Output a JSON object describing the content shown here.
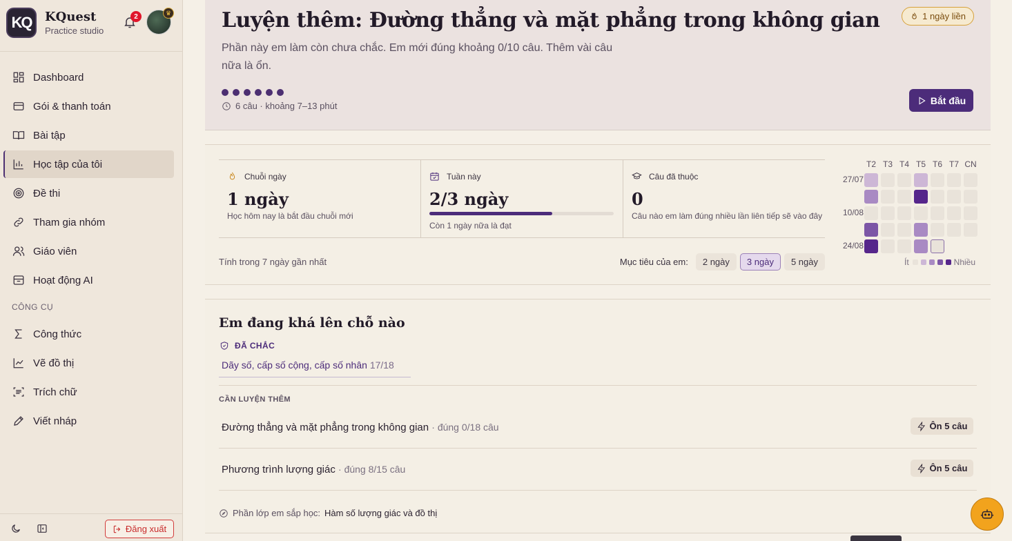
{
  "brand": {
    "logo_text": "KQ",
    "name": "KQuest",
    "subtitle": "Practice studio"
  },
  "notifications": {
    "count": "2"
  },
  "nav": {
    "items": [
      {
        "label": "Dashboard",
        "icon": "dashboard-icon"
      },
      {
        "label": "Gói & thanh toán",
        "icon": "wallet-icon"
      },
      {
        "label": "Bài tập",
        "icon": "book-icon"
      },
      {
        "label": "Học tập của tôi",
        "icon": "chart-icon",
        "active": true
      },
      {
        "label": "Đề thi",
        "icon": "target-icon"
      },
      {
        "label": "Tham gia nhóm",
        "icon": "link-icon"
      },
      {
        "label": "Giáo viên",
        "icon": "users-icon"
      },
      {
        "label": "Hoạt động AI",
        "icon": "archive-icon"
      }
    ],
    "tools_heading": "CÔNG CỤ",
    "tools": [
      {
        "label": "Công thức",
        "icon": "sigma-icon"
      },
      {
        "label": "Vẽ đồ thị",
        "icon": "line-chart-icon"
      },
      {
        "label": "Trích chữ",
        "icon": "scan-text-icon"
      },
      {
        "label": "Viết nháp",
        "icon": "pencil-icon"
      }
    ],
    "logout_label": "Đăng xuất"
  },
  "hero": {
    "title": "Luyện thêm: Đường thẳng và mặt phẳng trong không gian",
    "streak_pill": "1 ngày liền",
    "description": "Phần này em làm còn chưa chắc. Em mới đúng khoảng 0/10 câu. Thêm vài câu nữa là ổn.",
    "question_dots": 6,
    "meta": "6 câu · khoảng 7–13 phút",
    "start_label": "Bắt đầu"
  },
  "stats": {
    "streak": {
      "label": "Chuỗi ngày",
      "value": "1 ngày",
      "sub": "Học hôm nay là bắt đầu chuỗi mới"
    },
    "week": {
      "label": "Tuần này",
      "value": "2/3 ngày",
      "progress": 0.667,
      "sub": "Còn 1 ngày nữa là đạt"
    },
    "mastered": {
      "label": "Câu đã thuộc",
      "value": "0",
      "sub": "Câu nào em làm đúng nhiều lần liên tiếp sẽ vào đây"
    },
    "range_label": "Tính trong 7 ngày gần nhất",
    "goal_label": "Mục tiêu của em:",
    "goal_options": [
      "2 ngày",
      "3 ngày",
      "5 ngày"
    ],
    "goal_selected": 1
  },
  "heatmap": {
    "days": [
      "T2",
      "T3",
      "T4",
      "T5",
      "T6",
      "T7",
      "CN"
    ],
    "row_labels": [
      "27/07",
      "",
      "10/08",
      "",
      "24/08"
    ],
    "levels": [
      [
        1,
        0,
        0,
        1,
        0,
        0,
        0
      ],
      [
        2,
        0,
        0,
        4,
        0,
        0,
        0
      ],
      [
        0,
        0,
        0,
        0,
        0,
        0,
        0
      ],
      [
        3,
        0,
        0,
        2,
        0,
        0,
        0
      ],
      [
        4,
        0,
        0,
        2,
        -1,
        null,
        null
      ]
    ],
    "colors": [
      "#e9e3da",
      "#cdb7d6",
      "#a98ac3",
      "#7c56a6",
      "#56268b"
    ],
    "legend_less": "Ít",
    "legend_more": "Nhiều"
  },
  "progress": {
    "title": "Em đang khá lên chỗ nào",
    "mastered_heading": "ĐÃ CHẮC",
    "mastered_items": [
      {
        "topic": "Dãy số, cấp số cộng, cấp số nhân",
        "score": "17/18"
      }
    ],
    "practice_heading": "CẦN LUYỆN THÊM",
    "practice_items": [
      {
        "topic": "Đường thẳng và mặt phẳng trong không gian",
        "meta": "· đúng 0/18 câu",
        "button": "Ôn 5 câu"
      },
      {
        "topic": "Phương trình lượng giác",
        "meta": "· đúng 8/15 câu",
        "button": "Ôn 5 câu"
      }
    ],
    "next_label": "Phần lớp em sắp học:",
    "next_topic": "Hàm số lượng giác và đồ thị"
  }
}
